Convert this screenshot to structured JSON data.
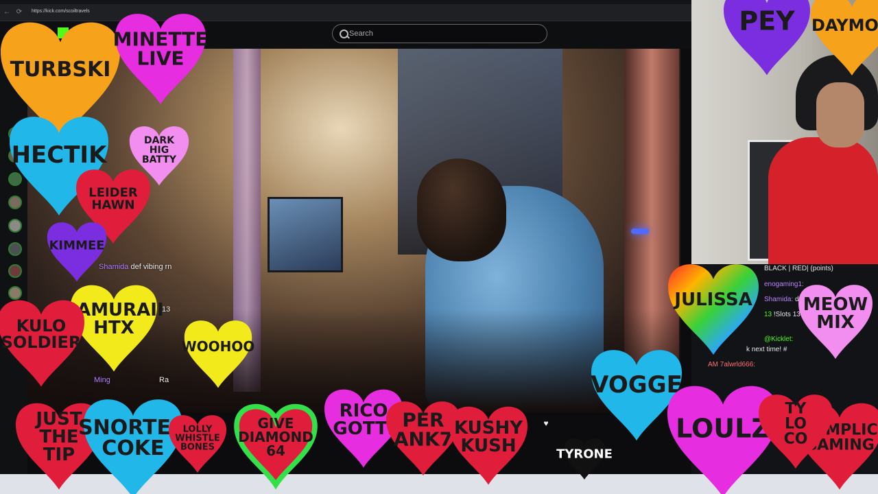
{
  "browser": {
    "url": "https://kick.com/scoiltravels",
    "back": "←",
    "reload": "⟳"
  },
  "search": {
    "placeholder": "Search"
  },
  "overlay_chat": [
    {
      "user": "Shamida",
      "text": " def vibing rn"
    },
    {
      "user": "",
      "text": "13"
    },
    {
      "user": "Ming",
      "text": ""
    },
    {
      "user": "",
      "text": "Ra"
    }
  ],
  "chat": {
    "header": "BLACK | RED| (points)",
    "lines": [
      {
        "user": "enogaming1:",
        "text": ""
      },
      {
        "user": "Shamida:",
        "text": " def"
      },
      {
        "user": "13",
        "text": " !Slots 13"
      },
      {
        "user": "@Kicklet:",
        "text": ""
      },
      {
        "user": "",
        "text": "k next time! #"
      },
      {
        "user": "AM 7alwrld666:",
        "text": ""
      }
    ]
  },
  "hearts": [
    {
      "label": "TURBSKI",
      "color": "#f7a21b"
    },
    {
      "label": "MINETTE LIVE",
      "color": "#e62ee0"
    },
    {
      "label": "DARK HIG BATTY",
      "color": "#f18ef0"
    },
    {
      "label": "HECTIK",
      "color": "#21b7e8"
    },
    {
      "label": "LEIDER HAWN",
      "color": "#e01e3c"
    },
    {
      "label": "KIMMEE",
      "color": "#7b2ee0"
    },
    {
      "label": "SAMURAII HTX",
      "color": "#f2ea1a"
    },
    {
      "label": "KULO SOLDIER",
      "color": "#e01e3c"
    },
    {
      "label": "WOOHOO",
      "color": "#f2ea1a"
    },
    {
      "label": "JUST THE TIP",
      "color": "#e01e3c"
    },
    {
      "label": "SNORTED COKE",
      "color": "#21b7e8"
    },
    {
      "label": "LOLLY WHISTLE BONES",
      "color": "#e01e3c"
    },
    {
      "label": "GIVE DIAMOND 64",
      "color": "#e01e3c"
    },
    {
      "label": "RICO GOTTI",
      "color": "#e62ee0"
    },
    {
      "label": "PER ANK7",
      "color": "#e01e3c"
    },
    {
      "label": "KUSHY KUSH",
      "color": "#e01e3c"
    },
    {
      "label": "TYRONE",
      "color": "#111111"
    },
    {
      "label": "VOGGE",
      "color": "#21b7e8"
    },
    {
      "label": "LOULZ",
      "color": "#e62ee0"
    },
    {
      "label": "COMPLIC GAMING",
      "color": "#e01e3c"
    },
    {
      "label": "TY LO CO",
      "color": "#e01e3c"
    },
    {
      "label": "JULISSA",
      "color": "#ff6a00"
    },
    {
      "label": "MEOW MIX",
      "color": "#f18ef0"
    },
    {
      "label": "PEY",
      "color": "#7b2ee0"
    },
    {
      "label": "DAYMON",
      "color": "#f7a21b"
    }
  ],
  "colors": {
    "kick_green": "#53fc18",
    "chat_bg": "#121316",
    "webcam_shirt": "#d4212a"
  }
}
